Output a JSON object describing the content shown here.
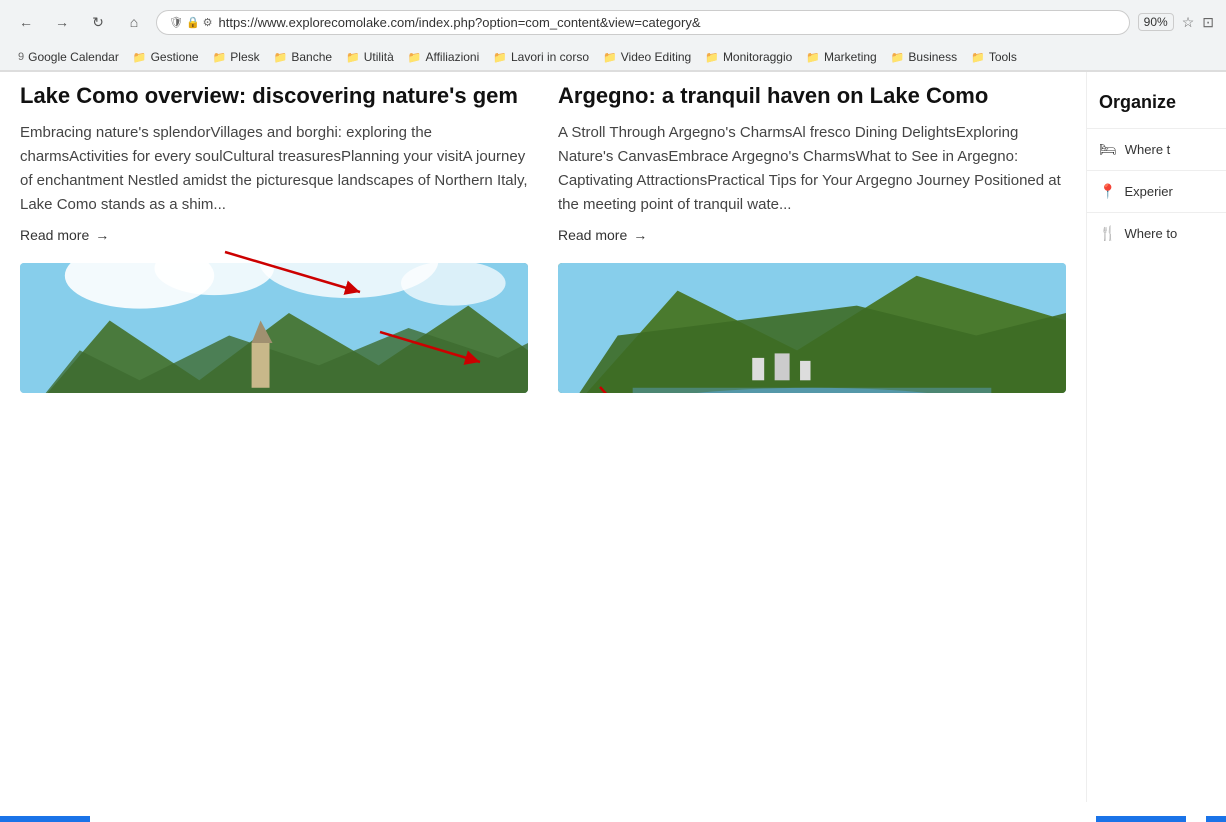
{
  "browser": {
    "url": "https://www.explorecomolake.com/index.php?option=com_content&view=category&",
    "zoom": "90%",
    "back_title": "back",
    "forward_title": "forward",
    "refresh_title": "refresh",
    "home_title": "home"
  },
  "bookmarks": [
    {
      "label": "Google Calendar",
      "icon": "📅"
    },
    {
      "label": "Gestione",
      "icon": "📁"
    },
    {
      "label": "Plesk",
      "icon": "📁"
    },
    {
      "label": "Banche",
      "icon": "📁"
    },
    {
      "label": "Utilità",
      "icon": "📁"
    },
    {
      "label": "Affiliazioni",
      "icon": "📁"
    },
    {
      "label": "Lavori in corso",
      "icon": "📁"
    },
    {
      "label": "Video Editing",
      "icon": "📁"
    },
    {
      "label": "Monitoraggio",
      "icon": "📁"
    },
    {
      "label": "Marketing",
      "icon": "📁"
    },
    {
      "label": "Business",
      "icon": "📁"
    },
    {
      "label": "Tools",
      "icon": "📁"
    }
  ],
  "articles": [
    {
      "id": "lake-como",
      "title": "Lake Como overview: discovering nature's gem",
      "excerpt": "Embracing nature's splendorVillages and borghi: exploring the charmsActivities for every soulCultural treasuresPlanning your visitA journey of enchantment Nestled amidst the picturesque landscapes of Northern Italy, Lake Como stands as a shim...",
      "read_more": "Read more"
    },
    {
      "id": "argegno",
      "title": "Argegno: a tranquil haven on Lake Como",
      "excerpt": "A Stroll Through Argegno's CharmsAl fresco Dining DelightsExploring Nature's CanvasEmbrace Argegno's CharmsWhat to See in Argegno: Captivating AttractionsPractical Tips for Your Argegno Journey Positioned at the meeting point of tranquil wate...",
      "read_more": "Read more"
    }
  ],
  "sidebar": {
    "title": "Organize",
    "items": [
      {
        "label": "Where t",
        "icon": "bed"
      },
      {
        "label": "Experier",
        "icon": "marker"
      },
      {
        "label": "Where to",
        "icon": "fork-knife"
      }
    ]
  }
}
